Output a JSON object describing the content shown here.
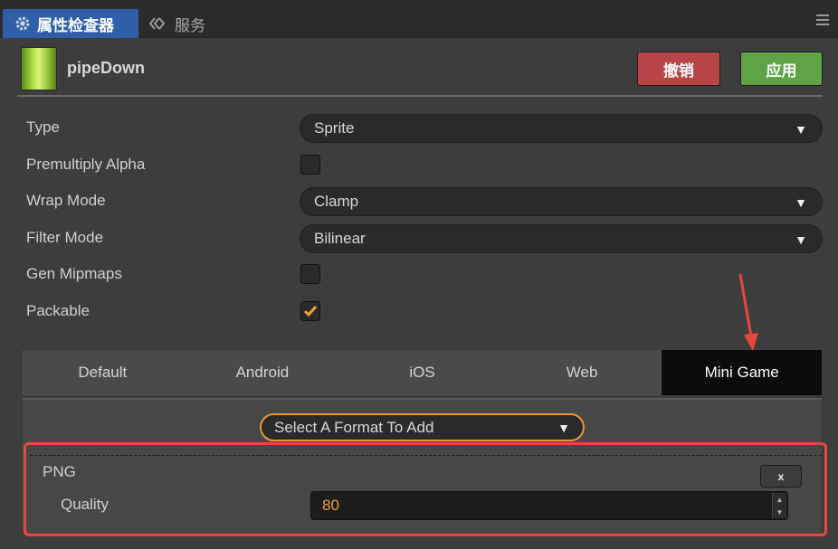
{
  "tabs": {
    "active_label": "属性检查器",
    "inactive_label": "服务"
  },
  "asset": {
    "name": "pipeDown"
  },
  "buttons": {
    "revert_label": "撤销",
    "apply_label": "应用"
  },
  "properties": {
    "type_label": "Type",
    "type_value": "Sprite",
    "premultiply_label": "Premultiply Alpha",
    "premultiply_checked": false,
    "wrap_label": "Wrap Mode",
    "wrap_value": "Clamp",
    "filter_label": "Filter Mode",
    "filter_value": "Bilinear",
    "mipmaps_label": "Gen Mipmaps",
    "mipmaps_checked": false,
    "packable_label": "Packable",
    "packable_checked": true
  },
  "platforms": {
    "tabs": [
      "Default",
      "Android",
      "iOS",
      "Web",
      "Mini Game"
    ],
    "active": "Mini Game"
  },
  "format": {
    "select_placeholder": "Select A Format To Add",
    "format_name": "PNG",
    "remove_label": "x",
    "quality_label": "Quality",
    "quality_value": "80"
  },
  "colors": {
    "accent_tab": "#2f5fa8",
    "revert": "#b94547",
    "apply": "#5ea346",
    "checkbox_tick": "#f0a030",
    "highlight_box": "#e8473d",
    "format_border": "#e7963a"
  }
}
